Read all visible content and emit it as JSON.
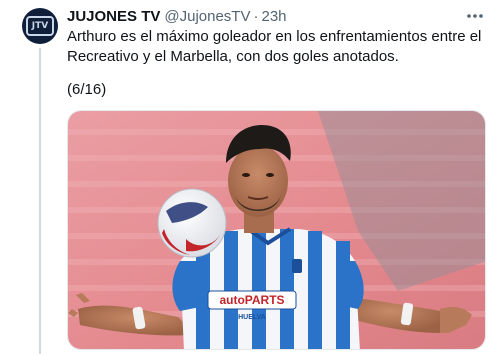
{
  "tweet": {
    "author_name": "JUJONES TV",
    "handle": "@JujonesTV",
    "separator": "·",
    "time": "23h",
    "avatar_text": "JTV",
    "text": "Arthuro es el máximo goleador en los enfrentamientos entre el Recreativo y el Marbella, con dos goles anotados.",
    "counter": "(6/16)",
    "more_icon": "more-horizontal-icon"
  },
  "photo": {
    "shirt_sponsor": "autoPARTS",
    "shirt_city": "HUELVA",
    "colors": {
      "stands": "#e48a8f",
      "shirt_blue": "#2a73c8",
      "shirt_white": "#f4f6fa"
    }
  }
}
